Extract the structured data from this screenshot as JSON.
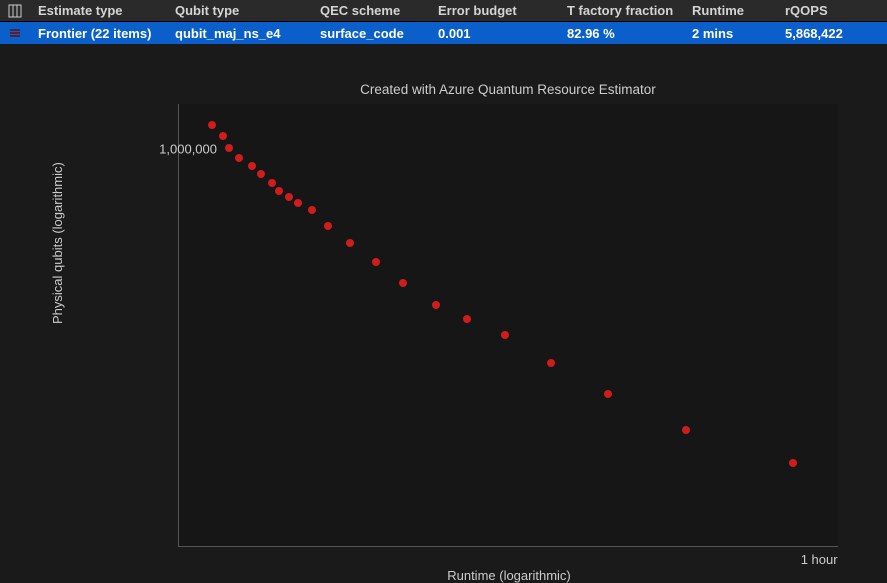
{
  "table": {
    "headers": {
      "estimate_type": "Estimate type",
      "qubit_type": "Qubit type",
      "qec_scheme": "QEC scheme",
      "error_budget": "Error budget",
      "t_factory_fraction": "T factory fraction",
      "runtime": "Runtime",
      "rqops": "rQOPS"
    },
    "row": {
      "estimate_type": "Frontier (22 items)",
      "qubit_type": "qubit_maj_ns_e4",
      "qec_scheme": "surface_code",
      "error_budget": "0.001",
      "t_factory_fraction": "82.96 %",
      "runtime": "2 mins",
      "rqops": "5,868,422"
    }
  },
  "chart": {
    "title": "Created with Azure Quantum Resource Estimator",
    "xlabel": "Runtime (logarithmic)",
    "ylabel": "Physical qubits (logarithmic)",
    "y_tick_label": "1,000,000",
    "x_tick_label": "1 hour",
    "point_color": "#d01c1c"
  },
  "chart_data": {
    "type": "scatter",
    "title": "Created with Azure Quantum Resource Estimator",
    "xlabel": "Runtime (logarithmic)",
    "ylabel": "Physical qubits (logarithmic)",
    "x_scale": "log",
    "y_scale": "log",
    "x_unit": "seconds",
    "y_unit": "physical qubits",
    "xlim": [
      100,
      4000
    ],
    "ylim": [
      200000,
      1200000
    ],
    "series": [
      {
        "name": "Frontier",
        "color": "#d01c1c",
        "points": [
          {
            "x": 120,
            "y": 1100000
          },
          {
            "x": 128,
            "y": 1050000
          },
          {
            "x": 132,
            "y": 1000000
          },
          {
            "x": 140,
            "y": 960000
          },
          {
            "x": 150,
            "y": 930000
          },
          {
            "x": 158,
            "y": 900000
          },
          {
            "x": 168,
            "y": 870000
          },
          {
            "x": 175,
            "y": 840000
          },
          {
            "x": 185,
            "y": 820000
          },
          {
            "x": 195,
            "y": 800000
          },
          {
            "x": 210,
            "y": 780000
          },
          {
            "x": 230,
            "y": 730000
          },
          {
            "x": 260,
            "y": 680000
          },
          {
            "x": 300,
            "y": 630000
          },
          {
            "x": 350,
            "y": 580000
          },
          {
            "x": 420,
            "y": 530000
          },
          {
            "x": 500,
            "y": 500000
          },
          {
            "x": 620,
            "y": 470000
          },
          {
            "x": 800,
            "y": 420000
          },
          {
            "x": 1100,
            "y": 370000
          },
          {
            "x": 1700,
            "y": 320000
          },
          {
            "x": 3100,
            "y": 280000
          }
        ]
      }
    ],
    "x_ticks": [
      {
        "value": 3600,
        "label": "1 hour"
      }
    ],
    "y_ticks": [
      {
        "value": 1000000,
        "label": "1,000,000"
      }
    ]
  }
}
